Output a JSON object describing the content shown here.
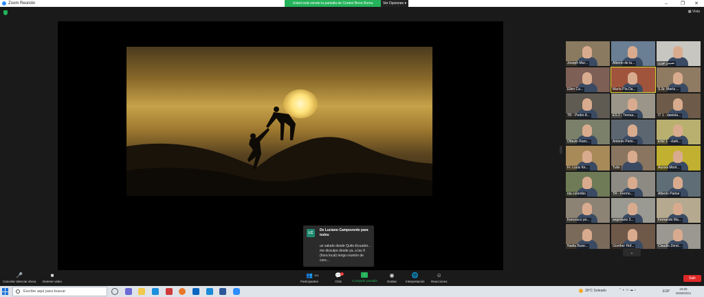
{
  "window": {
    "title": "Zoom Reunión",
    "share_banner": "Usted está viendo la pantalla de Control Bono Roma",
    "options_label": "Ver Opciones",
    "controls": [
      "–",
      "❐",
      "✕"
    ]
  },
  "top_right": {
    "view_label": "Vista"
  },
  "chat_notification": {
    "avatar_initials": "LC",
    "from": "De Luciano Campoverde para todos",
    "message": "un saludo desde Quito-Ecuador... me disculpo desde ya, a las 9 (hora local) tengo reunión de core..."
  },
  "participants": [
    {
      "name": "Joseph Mur..."
    },
    {
      "name": "Alberto de la..."
    },
    {
      "name": "نصیبی تورن"
    },
    {
      "name": "Ellen Ca..."
    },
    {
      "name": "María Pía Da..."
    },
    {
      "name": "S.Sr. María ..."
    },
    {
      "name": "TR - Pedro A..."
    },
    {
      "name": "ES 2 - Teresa..."
    },
    {
      "name": "IT 1 - daniela..."
    },
    {
      "name": "Ottavio Ranc..."
    },
    {
      "name": "Antonio Pieto..."
    },
    {
      "name": "ENZ 1 - clark..."
    },
    {
      "name": "Fr. Louis Ke..."
    },
    {
      "name": "Tulio"
    },
    {
      "name": "Aurora Mont..."
    },
    {
      "name": "ida colombo"
    },
    {
      "name": "TR - Fermo..."
    },
    {
      "name": "Alberto Parise"
    },
    {
      "name": "francesco pe..."
    },
    {
      "name": "segretario 3..."
    },
    {
      "name": "Fernando Ma..."
    },
    {
      "name": "Nadia Buse..."
    },
    {
      "name": "Günther Hof..."
    },
    {
      "name": "Claudio Zend..."
    }
  ],
  "toolbar": {
    "mute_label": "Cancelar silenciar ahora",
    "video_label": "Detener video",
    "participants_label": "Participantes",
    "participants_count": "101",
    "chat_label": "Chat",
    "chat_badge": "1",
    "share_label": "Compartir pantalla",
    "record_label": "Grabar",
    "interpret_label": "Interpretación",
    "reactions_label": "Reacciones",
    "leave_label": "Salir"
  },
  "taskbar": {
    "search_placeholder": "Escribe aquí para buscar",
    "weather": "30°C  Soleado",
    "language": "ESP",
    "time": "15:05",
    "date": "25/06/2021"
  },
  "colors": {
    "accent_green": "#24b35a",
    "leave_red": "#e02828",
    "zoom_blue": "#2d8cff"
  }
}
